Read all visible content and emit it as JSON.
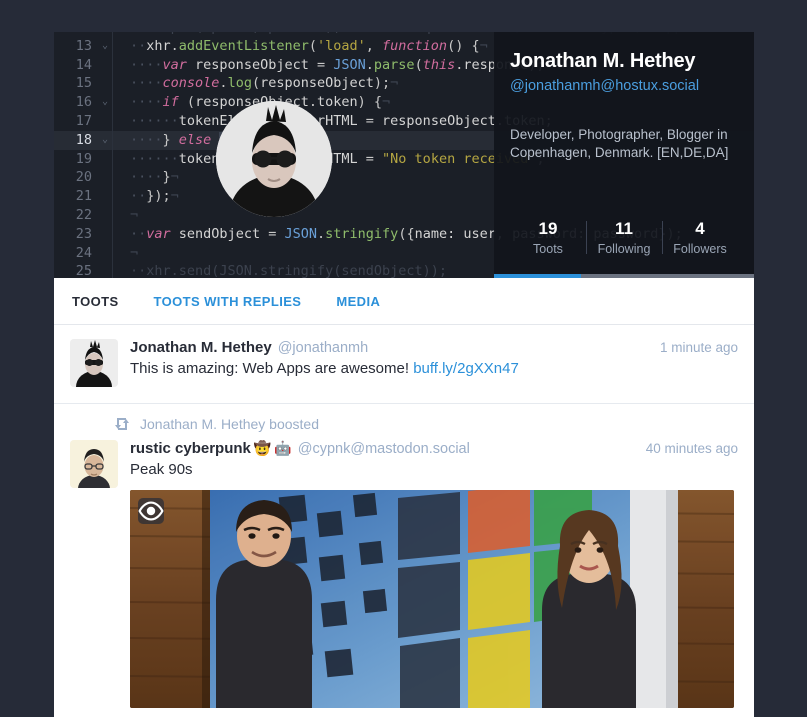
{
  "editor": {
    "lines": [
      {
        "num": "13",
        "fold": true,
        "current": false
      },
      {
        "num": "14",
        "fold": false,
        "current": false
      },
      {
        "num": "15",
        "fold": false,
        "current": false
      },
      {
        "num": "16",
        "fold": true,
        "current": false
      },
      {
        "num": "17",
        "fold": false,
        "current": false
      },
      {
        "num": "18",
        "fold": true,
        "current": true
      },
      {
        "num": "19",
        "fold": false,
        "current": false
      },
      {
        "num": "20",
        "fold": false,
        "current": false
      },
      {
        "num": "21",
        "fold": false,
        "current": false
      },
      {
        "num": "22",
        "fold": false,
        "current": false
      },
      {
        "num": "23",
        "fold": false,
        "current": false
      },
      {
        "num": "24",
        "fold": false,
        "current": false
      }
    ],
    "code_text": [
      "xhr.addEventListener('load', function() {",
      "var responseObject = JSON.parse(this.response);",
      "console.log(responseObject);",
      "if (responseObject.token) {",
      "tokenElement.innerHTML = responseObject.token;",
      "} else {",
      "tokenElement.innerHTML = \"No token received\";",
      "}",
      "});",
      "",
      "var sendObject = JSON.stringify({name: user, password: password});",
      ""
    ]
  },
  "profile": {
    "display_name": "Jonathan M. Hethey",
    "handle": "@jonathanmh@hostux.social",
    "bio": "Developer, Photographer, Blogger in Copenhagen, Denmark. [EN,DE,DA]",
    "avatar_icon": "profile-avatar-photo",
    "stats": [
      {
        "value": "19",
        "label": "Toots",
        "active": true
      },
      {
        "value": "11",
        "label": "Following",
        "active": false
      },
      {
        "value": "4",
        "label": "Followers",
        "active": false
      }
    ],
    "accent_color": "#2b90d9"
  },
  "tabs": [
    {
      "label": "TOOTS",
      "active": true
    },
    {
      "label": "TOOTS WITH REPLIES",
      "active": false
    },
    {
      "label": "MEDIA",
      "active": false
    }
  ],
  "toots": [
    {
      "author_name": "Jonathan M. Hethey",
      "author_acct": "@jonathanmh",
      "timestamp": "1 minute ago",
      "text_before_link": "This is amazing: Web Apps are awesome! ",
      "link_text": "buff.ly/2gXXn47",
      "avatar_icon": "toot-avatar-photo"
    }
  ],
  "boosted_toot": {
    "boost_label": "Jonathan M. Hethey boosted",
    "boost_icon": "boost-icon",
    "author_name": "rustic cyberpunk",
    "author_emoji_1": "🤠",
    "author_emoji_2": "🤖",
    "author_acct": "@cypnk@mastodon.social",
    "timestamp": "40 minutes ago",
    "text": "Peak 90s",
    "avatar_icon": "boosted-avatar-illustration",
    "media": {
      "alt": "Windows 95 promotional poster with two people in front of Windows logo on wooden wall",
      "toggle_icon": "eye-icon"
    }
  }
}
